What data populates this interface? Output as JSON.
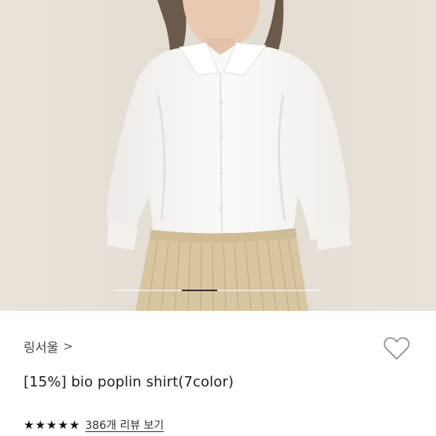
{
  "product": {
    "store_name": "링서울",
    "store_chevron": ">",
    "title": "[15%] bio poplin shirt(7color)",
    "rating_stars": 5,
    "review_count_label": "386개",
    "review_link_label": "리뷰 보기"
  },
  "carousel": {
    "current_position": 0.33
  },
  "icons": {
    "wishlist": "heart-outline-icon",
    "star": "star-icon"
  },
  "colors": {
    "photo_background": "#e4ddd3",
    "shirt": "#f7f7f5",
    "skirt": "#d9c7a2"
  }
}
